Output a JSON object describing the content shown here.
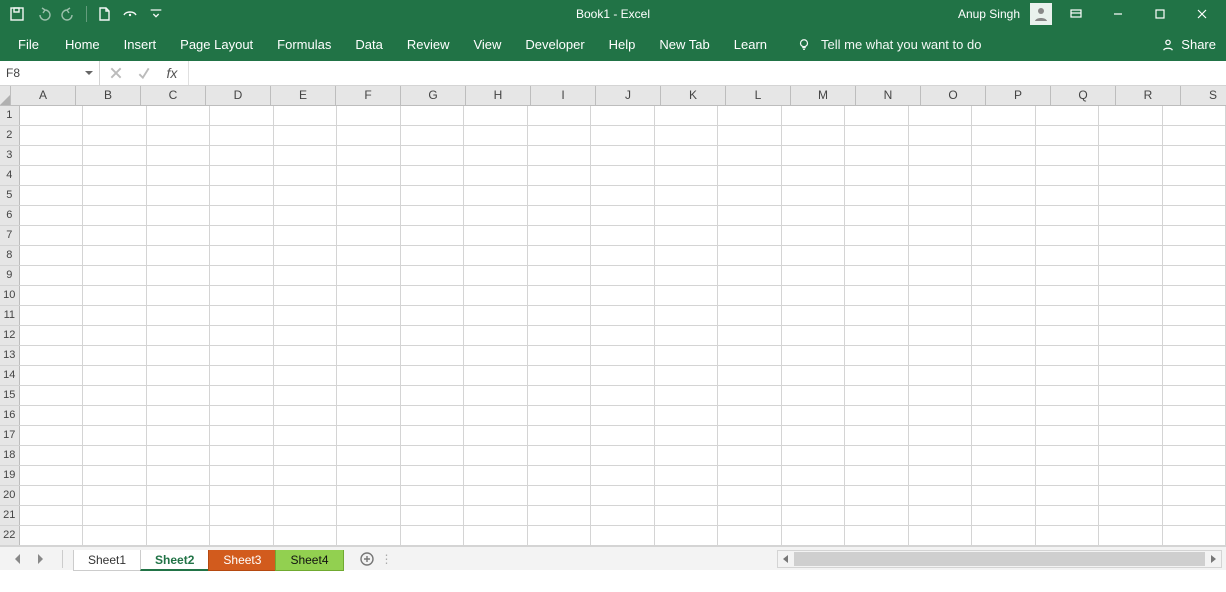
{
  "title": "Book1  -  Excel",
  "user": "Anup Singh",
  "qat": {
    "save": "Save",
    "undo": "Undo",
    "redo": "Redo",
    "new": "New",
    "touch": "Touch/Mouse Mode",
    "more": "Customize"
  },
  "ribbon": {
    "tabs": [
      "File",
      "Home",
      "Insert",
      "Page Layout",
      "Formulas",
      "Data",
      "Review",
      "View",
      "Developer",
      "Help",
      "New Tab",
      "Learn"
    ],
    "tellme": "Tell me what you want to do",
    "share": "Share"
  },
  "formula_bar": {
    "name_box": "F8",
    "cancel": "Cancel",
    "enter": "Enter",
    "fx": "fx",
    "value": ""
  },
  "grid": {
    "columns": [
      "A",
      "B",
      "C",
      "D",
      "E",
      "F",
      "G",
      "H",
      "I",
      "J",
      "K",
      "L",
      "M",
      "N",
      "O",
      "P",
      "Q",
      "R",
      "S"
    ],
    "rows": [
      1,
      2,
      3,
      4,
      5,
      6,
      7,
      8,
      9,
      10,
      11,
      12,
      13,
      14,
      15,
      16,
      17,
      18,
      19,
      20,
      21,
      22
    ]
  },
  "sheets": [
    {
      "name": "Sheet1",
      "style": "plain"
    },
    {
      "name": "Sheet2",
      "style": "active"
    },
    {
      "name": "Sheet3",
      "style": "orange"
    },
    {
      "name": "Sheet4",
      "style": "green"
    }
  ],
  "new_sheet": "New sheet"
}
